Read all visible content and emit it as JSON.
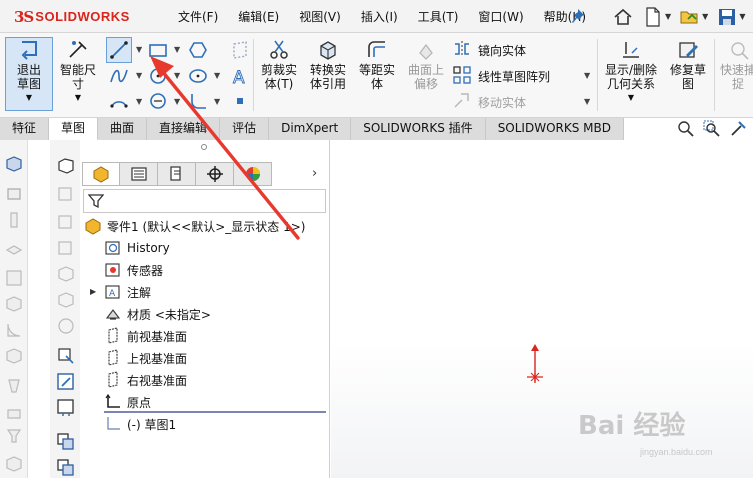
{
  "app": {
    "logo_prefix": "3S",
    "logo_name": "SOLIDWORKS"
  },
  "menu": [
    "文件(F)",
    "编辑(E)",
    "视图(V)",
    "插入(I)",
    "工具(T)",
    "窗口(W)",
    "帮助(H)"
  ],
  "ribbon": {
    "exit_sketch": "退出草图",
    "smart_dimension": "智能尺寸",
    "trim_entities": "剪裁实体(T)",
    "convert_entities": "转换实体引用",
    "offset_entities": "等距实体",
    "offset_on_surface": "曲面上偏移",
    "mirror_entities": "镜向实体",
    "linear_pattern": "线性草图阵列",
    "move_entities": "移动实体",
    "display_relations": "显示/删除几何关系",
    "repair_sketch": "修复草图",
    "quick_snaps": "快速捕捉"
  },
  "tabs": [
    "特征",
    "草图",
    "曲面",
    "直接编辑",
    "评估",
    "DimXpert",
    "SOLIDWORKS 插件",
    "SOLIDWORKS MBD"
  ],
  "active_tab": "草图",
  "tree": {
    "root": "零件1  (默认<<默认>_显示状态 1>)",
    "items": [
      "History",
      "传感器",
      "注解",
      "材质 <未指定>",
      "前视基准面",
      "上视基准面",
      "右视基准面",
      "原点",
      "(-) 草图1"
    ]
  },
  "watermark": {
    "main": "Bai 经验",
    "sub": "jingyan.baidu.com"
  },
  "colors": {
    "accent": "#d9251c",
    "selection": "#d7e6f7",
    "arrow": "#e8392f"
  }
}
